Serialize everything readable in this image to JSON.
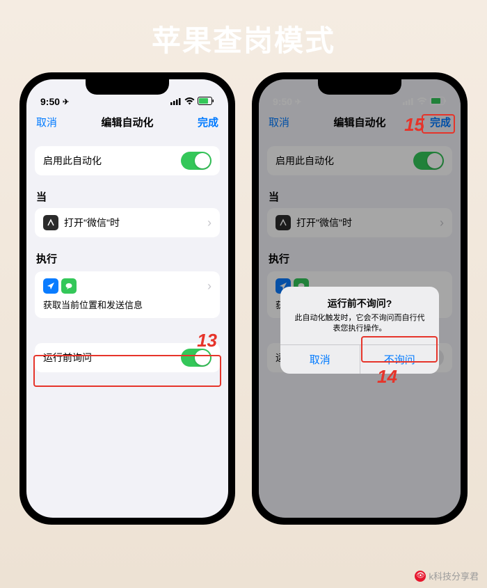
{
  "page_title": "苹果查岗模式",
  "status": {
    "time": "9:50",
    "location_arrow": "➤"
  },
  "nav": {
    "cancel": "取消",
    "title": "编辑自动化",
    "done": "完成"
  },
  "rows": {
    "enable": "启用此自动化",
    "when_header": "当",
    "when_text": "打开\"微信\"时",
    "do_header": "执行",
    "action_text": "获取当前位置和发送信息",
    "ask_before": "运行前询问"
  },
  "alert": {
    "title": "运行前不询问?",
    "message": "此自动化触发时，它会不询问而自行代表您执行操作。",
    "cancel": "取消",
    "confirm": "不询问"
  },
  "annotations": {
    "n13": "13",
    "n14": "14",
    "n15": "15"
  },
  "watermark": "k科技分享君"
}
